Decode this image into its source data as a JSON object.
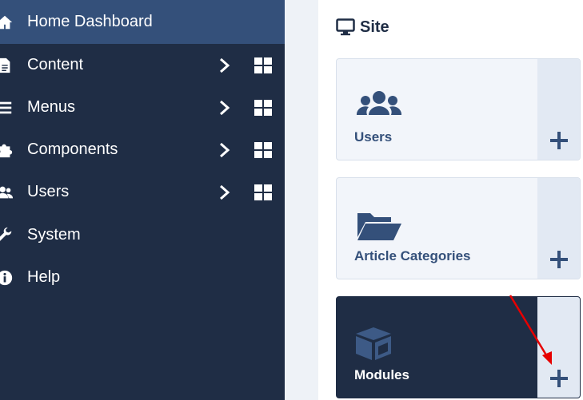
{
  "sidebar": {
    "items": [
      {
        "label": "Home Dashboard",
        "icon": "home-icon",
        "active": true,
        "has_chevron": false,
        "has_grid": false
      },
      {
        "label": "Content",
        "icon": "file-icon",
        "has_chevron": true,
        "has_grid": true
      },
      {
        "label": "Menus",
        "icon": "list-icon",
        "has_chevron": true,
        "has_grid": true
      },
      {
        "label": "Components",
        "icon": "puzzle-icon",
        "has_chevron": true,
        "has_grid": true
      },
      {
        "label": "Users",
        "icon": "users-icon",
        "has_chevron": true,
        "has_grid": true
      },
      {
        "label": "System",
        "icon": "wrench-icon",
        "has_chevron": false,
        "has_grid": false
      },
      {
        "label": "Help",
        "icon": "info-icon",
        "has_chevron": false,
        "has_grid": false
      }
    ]
  },
  "site": {
    "title": "Site",
    "icon": "monitor-icon",
    "cards": [
      {
        "label": "Users",
        "icon": "users-icon",
        "add_icon": "plus-icon"
      },
      {
        "label": "Article Categories",
        "icon": "folder-open-icon",
        "add_icon": "plus-icon"
      },
      {
        "label": "Modules",
        "icon": "cube-icon",
        "add_icon": "plus-icon",
        "highlighted": true
      }
    ]
  },
  "colors": {
    "sidebar_bg": "#1f2d45",
    "sidebar_active": "#34507a",
    "card_bg": "#f2f5fa",
    "card_add_bg": "#e2e9f3",
    "accent": "#34507a",
    "annotation_arrow": "#e60000"
  }
}
